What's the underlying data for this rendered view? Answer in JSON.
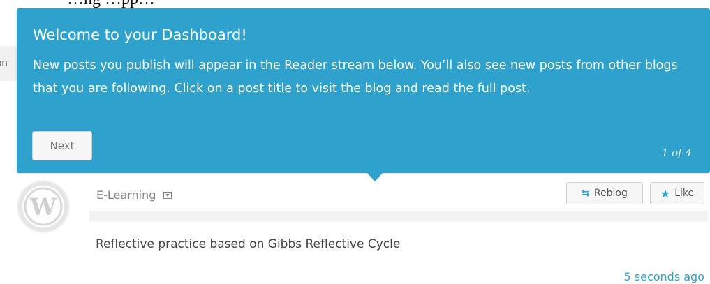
{
  "background": {
    "top_text": "…ng …pp…",
    "row_text": "on"
  },
  "tour": {
    "title": "Welcome to your Dashboard!",
    "body": "New posts you publish will appear in the Reader stream below. You’ll also see new posts from other blogs that you are following. Click on a post title to visit the blog and read the full post.",
    "next_label": "Next",
    "counter": "1 of 4",
    "color": "#2ea2cc"
  },
  "post": {
    "avatar_icon": "wordpress-logo-icon",
    "site_name": "E-Learning",
    "reblog_label": "Reblog",
    "like_label": "Like",
    "title": "Reflective practice based on Gibbs Reflective Cycle",
    "timestamp": "5 seconds ago"
  }
}
